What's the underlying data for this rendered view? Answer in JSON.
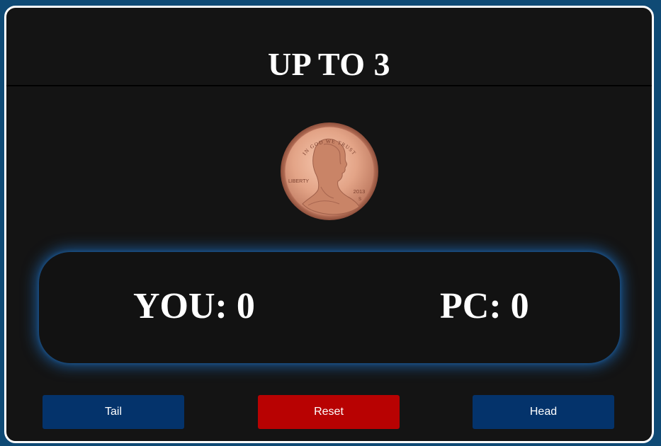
{
  "game": {
    "title": "UP TO 3"
  },
  "coin": {
    "icon": "penny-coin-icon",
    "text_top": "IN GOD WE TRUST",
    "text_left": "LIBERTY",
    "year": "2013",
    "mint_mark": "S",
    "colors": {
      "face": "#e3a487",
      "rim": "#b8705a",
      "shadow": "#8f4f3c"
    }
  },
  "score": {
    "you_text": "YOU: 0",
    "pc_text": "PC: 0"
  },
  "buttons": {
    "tail_label": "Tail",
    "reset_label": "Reset",
    "head_label": "Head"
  },
  "colors": {
    "background": "#0f4a75",
    "panel": "#141414",
    "button_blue": "#04336b",
    "button_red": "#b80202",
    "glow": "#1e6ebe"
  }
}
